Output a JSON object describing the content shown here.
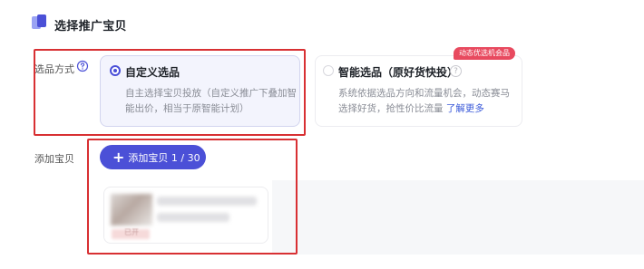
{
  "section": {
    "title": "选择推广宝贝",
    "icon": "section-marker-icon"
  },
  "mode_field": {
    "label": "选品方式",
    "help_icon": "question-mark-icon",
    "options": [
      {
        "title": "自定义选品",
        "desc": "自主选择宝贝投放（自定义推广下叠加智能出价，相当于原智能计划）",
        "selected": true
      },
      {
        "title": "智能选品（原好货快投）",
        "desc": "系统依据选品方向和流量机会，动态赛马选择好货，抢性价比流量",
        "link": "了解更多",
        "badge": "动态优选机会品",
        "selected": false
      }
    ]
  },
  "add_field": {
    "label": "添加宝贝",
    "button": "添加宝贝 1 / 30",
    "button_icon": "plus-icon",
    "product": {
      "tag_text": "已开"
    }
  },
  "colors": {
    "accent": "#4b50d7",
    "badge": "#e84a5f",
    "highlight_box": "#d83033"
  }
}
